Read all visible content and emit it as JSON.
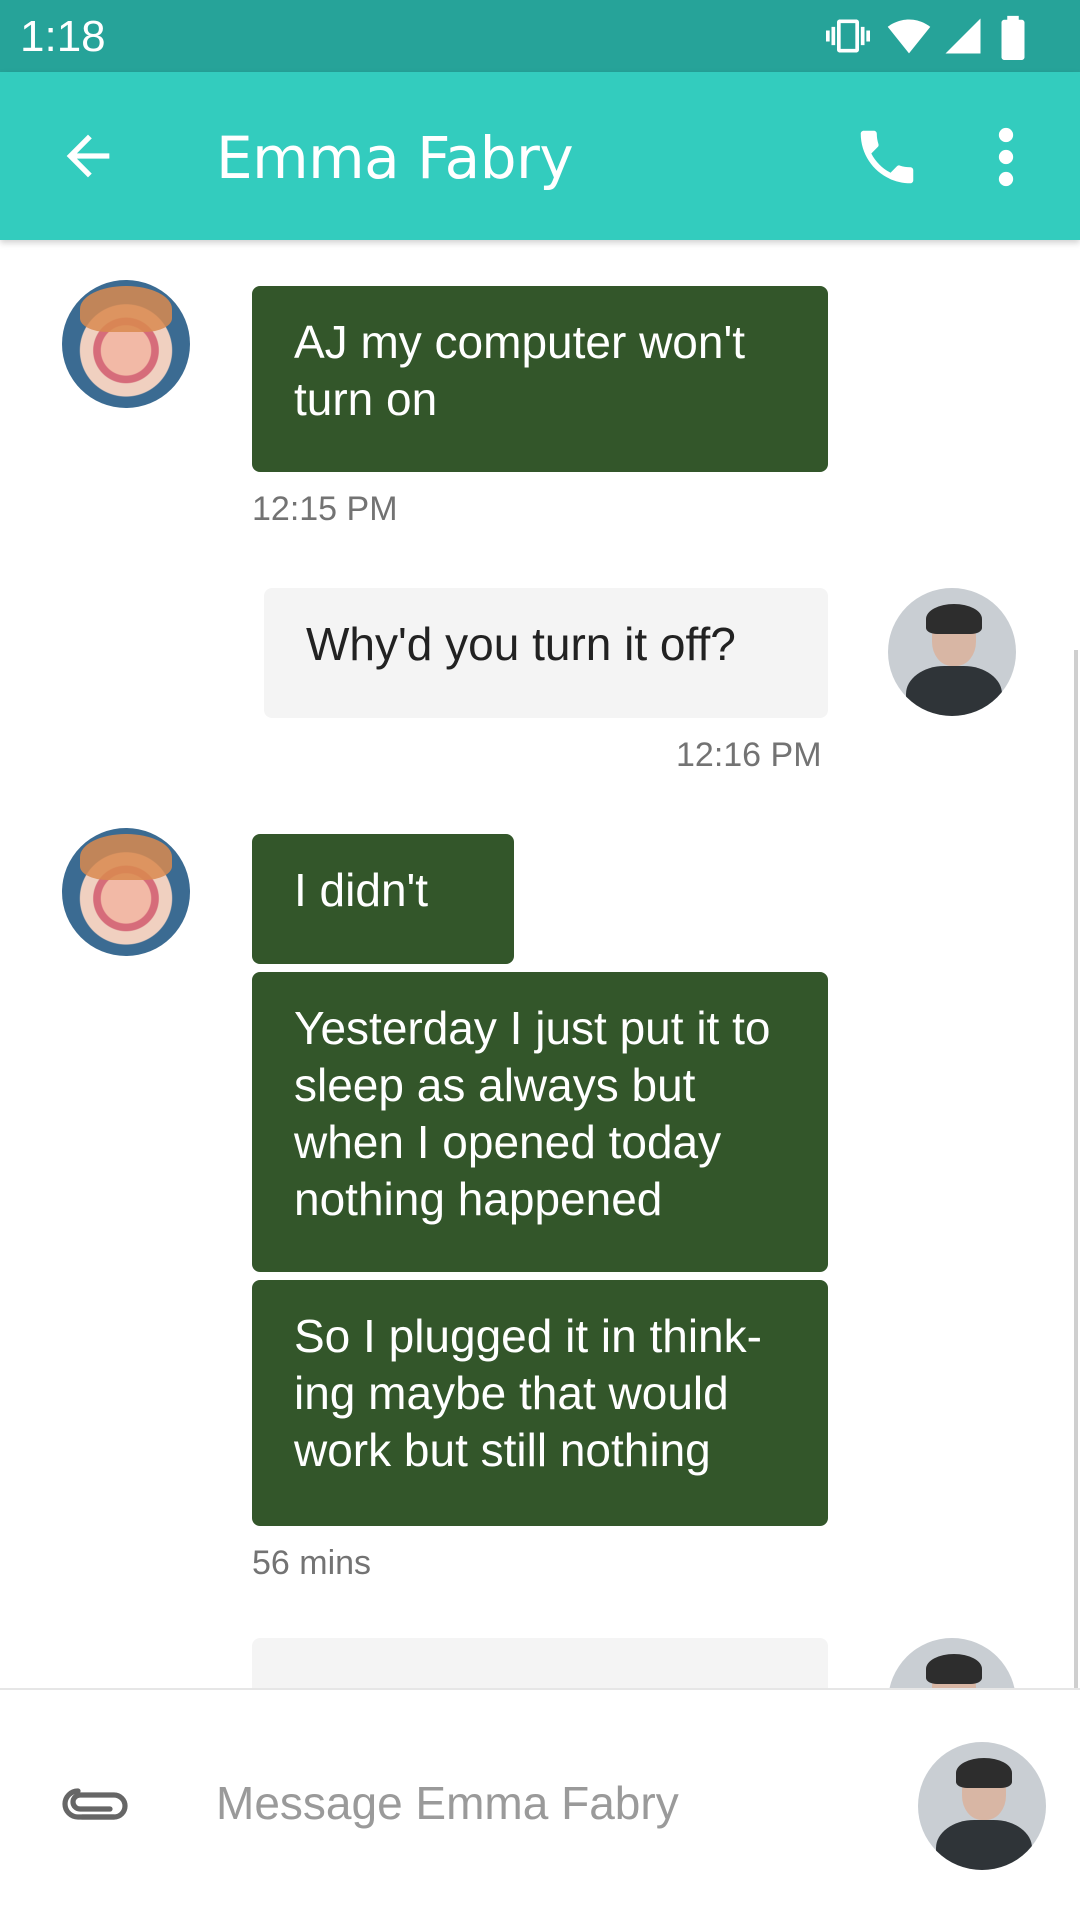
{
  "status_bar": {
    "time": "1:18",
    "icons": [
      "vibrate-icon",
      "wifi-icon",
      "signal-icon",
      "battery-icon"
    ]
  },
  "app_bar": {
    "title": "Emma Fabry",
    "icons": [
      "back-arrow-icon",
      "phone-icon",
      "more-vert-icon"
    ],
    "color": "#33ccbe",
    "status_color": "#26a399"
  },
  "messages": [
    {
      "sender": "Emma Fabry",
      "direction": "incoming",
      "bubbles": [
        "AJ my computer won't turn on"
      ],
      "time": "12:15 PM"
    },
    {
      "sender": "AJ",
      "direction": "outgoing",
      "bubbles": [
        "Why'd you turn it off?"
      ],
      "time": "12:16 PM"
    },
    {
      "sender": "Emma Fabry",
      "direction": "incoming",
      "bubbles": [
        "I didn't",
        "Yesterday I just put it to sleep as always but when I opened today nothing happened",
        "So I plugged it in think-ing maybe that would work but still nothing"
      ],
      "time": "56 mins"
    },
    {
      "sender": "AJ",
      "direction": "outgoing",
      "bubbles": [
        ""
      ],
      "time": ""
    }
  ],
  "colors": {
    "incoming_bubble": "#33562a",
    "outgoing_bubble": "#f4f4f4"
  },
  "composer": {
    "placeholder": "Message Emma Fabry",
    "value": ""
  }
}
